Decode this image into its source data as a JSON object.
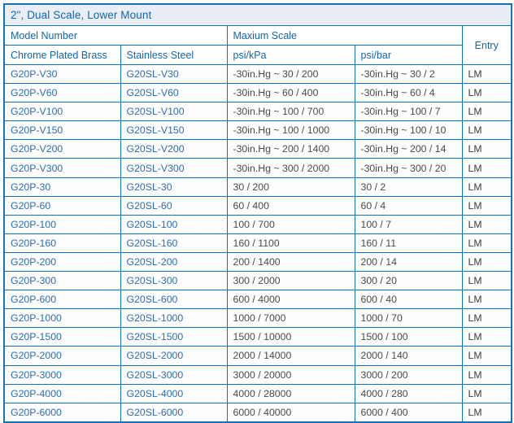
{
  "table": {
    "title": "2\", Dual Scale,  Lower Mount",
    "group_headers": {
      "model_number": "Model Number",
      "maxium_scale": "Maxium Scale",
      "entry": "Entry"
    },
    "column_headers": {
      "chrome_plated_brass": "Chrome Plated Brass",
      "stainless_steel": "Stainless Steel",
      "psi_kpa": "psi/kPa",
      "psi_bar": "psi/bar"
    },
    "colors": {
      "border": "#1273b8",
      "header_text": "#1266ad",
      "title_background": "#e9eef4",
      "model_text": "#2b6cb5",
      "value_text": "#4a4a4a",
      "row_background": "#fdfdfd"
    },
    "rows": [
      {
        "chrome_plated_brass": "G20P-V30",
        "stainless_steel": "G20SL-V30",
        "psi_kpa": "-30in.Hg ~ 30 / 200",
        "psi_bar": "-30in.Hg ~ 30 / 2",
        "entry": "LM"
      },
      {
        "chrome_plated_brass": "G20P-V60",
        "stainless_steel": "G20SL-V60",
        "psi_kpa": "-30in.Hg ~ 60 / 400",
        "psi_bar": "-30in.Hg ~ 60 / 4",
        "entry": "LM"
      },
      {
        "chrome_plated_brass": "G20P-V100",
        "stainless_steel": "G20SL-V100",
        "psi_kpa": "-30in.Hg ~ 100 / 700",
        "psi_bar": "-30in.Hg ~ 100 / 7",
        "entry": "LM"
      },
      {
        "chrome_plated_brass": "G20P-V150",
        "stainless_steel": "G20SL-V150",
        "psi_kpa": "-30in.Hg ~ 100 / 1000",
        "psi_bar": "-30in.Hg ~ 100 / 10",
        "entry": "LM"
      },
      {
        "chrome_plated_brass": "G20P-V200",
        "stainless_steel": "G20SL-V200",
        "psi_kpa": "-30in.Hg ~ 200 / 1400",
        "psi_bar": "-30in.Hg ~ 200 / 14",
        "entry": "LM"
      },
      {
        "chrome_plated_brass": "G20P-V300",
        "stainless_steel": "G20SL-V300",
        "psi_kpa": "-30in.Hg ~ 300 / 2000",
        "psi_bar": "-30in.Hg ~ 300 / 20",
        "entry": "LM"
      },
      {
        "chrome_plated_brass": "G20P-30",
        "stainless_steel": "G20SL-30",
        "psi_kpa": "30 / 200",
        "psi_bar": "30 / 2",
        "entry": "LM"
      },
      {
        "chrome_plated_brass": "G20P-60",
        "stainless_steel": "G20SL-60",
        "psi_kpa": "60 / 400",
        "psi_bar": "60 / 4",
        "entry": "LM"
      },
      {
        "chrome_plated_brass": "G20P-100",
        "stainless_steel": "G20SL-100",
        "psi_kpa": "100 / 700",
        "psi_bar": "100 / 7",
        "entry": "LM"
      },
      {
        "chrome_plated_brass": "G20P-160",
        "stainless_steel": "G20SL-160",
        "psi_kpa": "160 / 1100",
        "psi_bar": "160 / 11",
        "entry": "LM"
      },
      {
        "chrome_plated_brass": "G20P-200",
        "stainless_steel": "G20SL-200",
        "psi_kpa": "200 / 1400",
        "psi_bar": "200 / 14",
        "entry": "LM"
      },
      {
        "chrome_plated_brass": "G20P-300",
        "stainless_steel": "G20SL-300",
        "psi_kpa": "300 / 2000",
        "psi_bar": "300 / 20",
        "entry": "LM"
      },
      {
        "chrome_plated_brass": "G20P-600",
        "stainless_steel": "G20SL-600",
        "psi_kpa": "600 / 4000",
        "psi_bar": "600 / 40",
        "entry": "LM"
      },
      {
        "chrome_plated_brass": "G20P-1000",
        "stainless_steel": "G20SL-1000",
        "psi_kpa": "1000 / 7000",
        "psi_bar": "1000 / 70",
        "entry": "LM"
      },
      {
        "chrome_plated_brass": "G20P-1500",
        "stainless_steel": "G20SL-1500",
        "psi_kpa": "1500 / 10000",
        "psi_bar": "1500 / 100",
        "entry": "LM"
      },
      {
        "chrome_plated_brass": "G20P-2000",
        "stainless_steel": "G20SL-2000",
        "psi_kpa": "2000 / 14000",
        "psi_bar": "2000 / 140",
        "entry": "LM"
      },
      {
        "chrome_plated_brass": "G20P-3000",
        "stainless_steel": "G20SL-3000",
        "psi_kpa": "3000 / 20000",
        "psi_bar": "3000 / 200",
        "entry": "LM"
      },
      {
        "chrome_plated_brass": "G20P-4000",
        "stainless_steel": "G20SL-4000",
        "psi_kpa": "4000 / 28000",
        "psi_bar": "4000 / 280",
        "entry": "LM"
      },
      {
        "chrome_plated_brass": "G20P-6000",
        "stainless_steel": "G20SL-6000",
        "psi_kpa": "6000 / 40000",
        "psi_bar": "6000 / 400",
        "entry": "LM"
      }
    ]
  }
}
